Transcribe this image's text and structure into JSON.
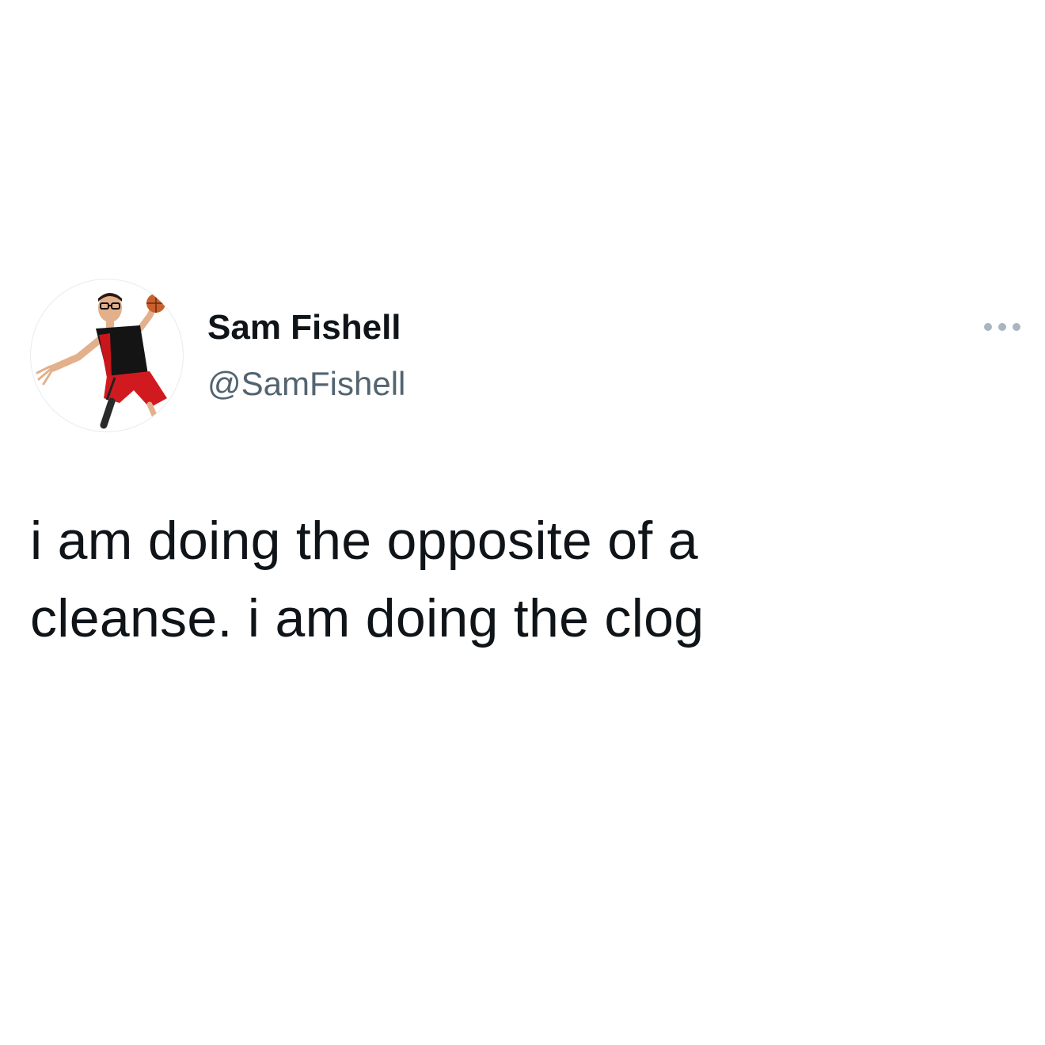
{
  "author": {
    "display_name": "Sam Fishell",
    "handle": "@SamFishell",
    "avatar_icon": "profile-photo"
  },
  "tweet": {
    "text_lines": [
      "i am doing the opposite of a",
      "cleanse. i am doing the clog"
    ]
  },
  "menu": {
    "more_icon": "more-horizontal-icon"
  },
  "colors": {
    "text_primary": "#0f1419",
    "text_secondary": "#536471",
    "icon_muted": "#a9b6c2",
    "background": "#ffffff"
  }
}
